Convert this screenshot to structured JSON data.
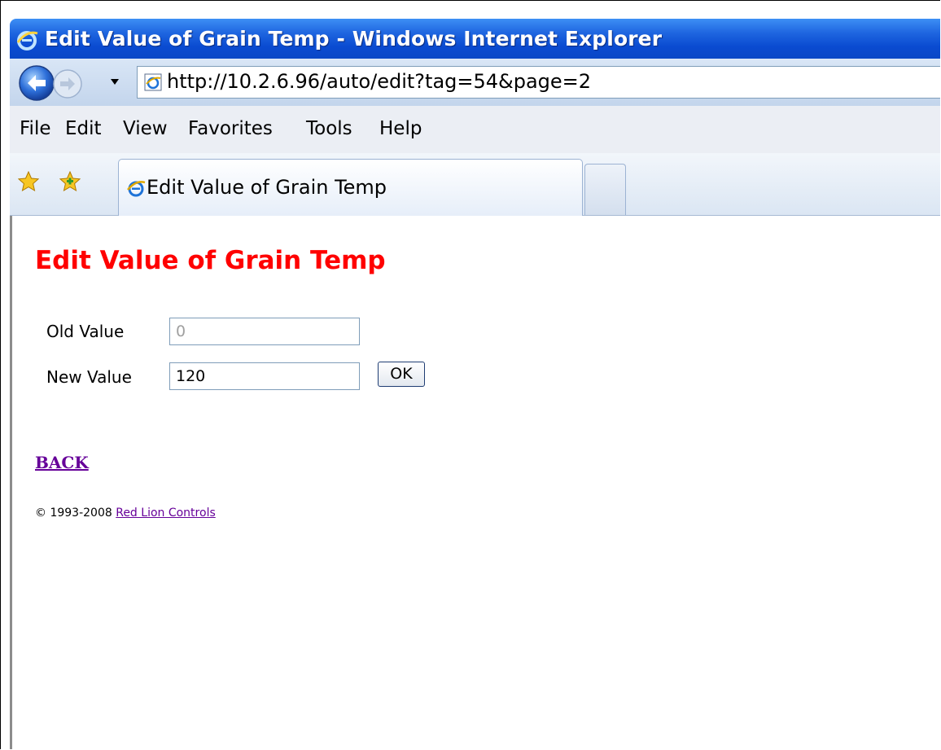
{
  "window": {
    "title": "Edit Value of Grain Temp - Windows Internet Explorer"
  },
  "address_bar": {
    "url": "http://10.2.6.96/auto/edit?tag=54&page=2"
  },
  "menu": {
    "items": [
      "File",
      "Edit",
      "View",
      "Favorites",
      "Tools",
      "Help"
    ]
  },
  "tabs": [
    {
      "label": "Edit Value of Grain Temp",
      "active": true
    }
  ],
  "page": {
    "title": "Edit Value of Grain Temp",
    "old_value_label": "Old Value",
    "old_value": "0",
    "new_value_label": "New Value",
    "new_value": "120",
    "ok_label": "OK",
    "back_label": "BACK",
    "footer_copyright": "© 1993-2008",
    "footer_link": "Red Lion Controls"
  },
  "colors": {
    "page_title": "#ff0000",
    "titlebar": "#0a4bd1",
    "visited_link": "#660099"
  }
}
